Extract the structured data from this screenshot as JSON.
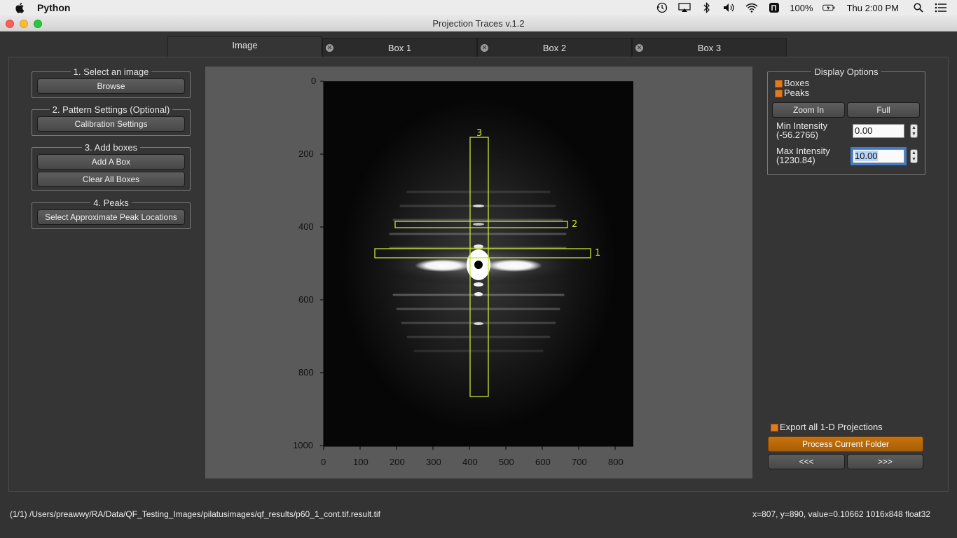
{
  "menubar": {
    "app_name": "Python",
    "battery": "100%",
    "clock": "Thu 2:00 PM"
  },
  "window": {
    "title": "Projection Traces v.1.2"
  },
  "tabs": [
    {
      "label": "Image",
      "active": true
    },
    {
      "label": "Box 1",
      "active": false
    },
    {
      "label": "Box 2",
      "active": false
    },
    {
      "label": "Box 3",
      "active": false
    }
  ],
  "left_panel": {
    "step1": {
      "title": "1. Select an image",
      "browse": "Browse"
    },
    "step2": {
      "title": "2. Pattern Settings (Optional)",
      "calibration": "Calibration Settings"
    },
    "step3": {
      "title": "3. Add boxes",
      "add_box": "Add A Box",
      "clear_boxes": "Clear All Boxes"
    },
    "step4": {
      "title": "4. Peaks",
      "select_peaks": "Select Approximate Peak Locations"
    }
  },
  "plot": {
    "y_ticks": [
      "0",
      "200",
      "400",
      "600",
      "800",
      "1000"
    ],
    "x_ticks": [
      "0",
      "100",
      "200",
      "300",
      "400",
      "500",
      "600",
      "700",
      "800"
    ],
    "boxes": [
      {
        "label": "1"
      },
      {
        "label": "2"
      },
      {
        "label": "3"
      }
    ]
  },
  "display_options": {
    "title": "Display Options",
    "boxes_label": "Boxes",
    "peaks_label": "Peaks",
    "zoom_in": "Zoom In",
    "full": "Full",
    "min_label": "Min Intensity",
    "min_range": "(-56.2766)",
    "min_value": "0.00",
    "max_label": "Max Intensity",
    "max_range": "(1230.84)",
    "max_value": "10.00"
  },
  "bottom_right": {
    "export_label": "Export all 1-D Projections",
    "process": "Process Current Folder",
    "prev": "<<<",
    "next": ">>>"
  },
  "status": {
    "path": "(1/1) /Users/preawwy/RA/Data/QF_Testing_Images/pilatusimages/qf_results/p60_1_cont.tif.result.tif",
    "pixel_info": "x=807, y=890, value=0.10662  1016x848 float32"
  },
  "colors": {
    "accent_orange": "#e07c1f",
    "box_outline": "#c8e632",
    "focus_blue": "#3e7bd2"
  }
}
